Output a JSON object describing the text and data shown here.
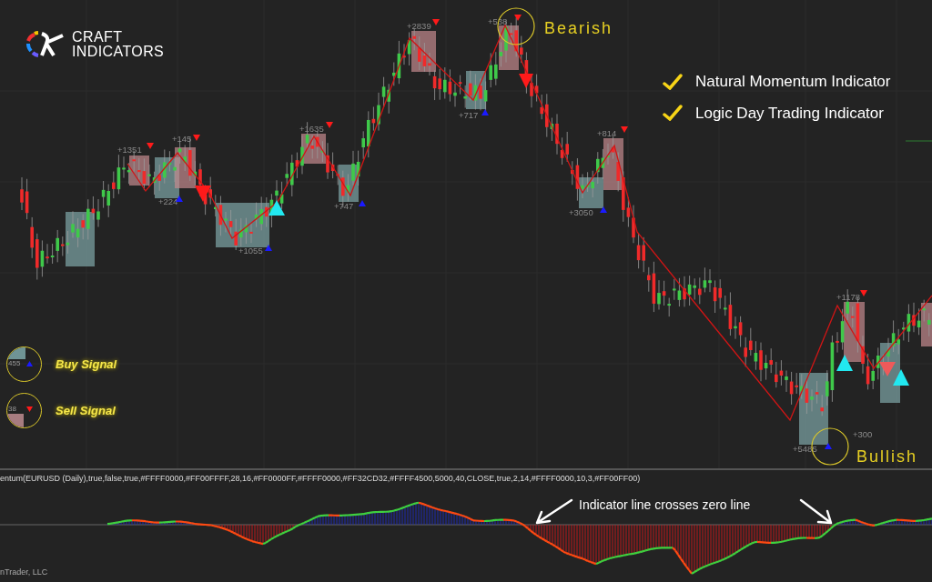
{
  "logo": {
    "line_1": "CRAFT",
    "line_2": "INDICATORS"
  },
  "features": [
    {
      "label": "Natural Momentum Indicator",
      "checked": true
    },
    {
      "label": "Logic Day Trading Indicator",
      "checked": true
    }
  ],
  "price_chart": {
    "trade_labels": [
      {
        "text": "+1351",
        "kind": "sell"
      },
      {
        "text": "+145",
        "kind": "sell"
      },
      {
        "text": "+224",
        "kind": "buy"
      },
      {
        "text": "+1055",
        "kind": "buy"
      },
      {
        "text": "+1635",
        "kind": "sell"
      },
      {
        "text": "+747",
        "kind": "buy"
      },
      {
        "text": "+2839",
        "kind": "sell"
      },
      {
        "text": "+717",
        "kind": "buy"
      },
      {
        "text": "+538",
        "kind": "sell"
      },
      {
        "text": "+814",
        "kind": "sell"
      },
      {
        "text": "+3050",
        "kind": "buy"
      },
      {
        "text": "+1178",
        "kind": "sell"
      },
      {
        "text": "+5485",
        "kind": "buy"
      },
      {
        "text": "+300",
        "kind": "plain"
      }
    ],
    "callouts": [
      {
        "text": "Bearish"
      },
      {
        "text": "Bullish"
      }
    ]
  },
  "legend": [
    {
      "kind": "buy",
      "sample": "455",
      "label": "Buy Signal"
    },
    {
      "kind": "sell",
      "sample": "38",
      "label": "Sell Signal"
    }
  ],
  "indicator_panel": {
    "parameters": "entum(EURUSD (Daily),true,false,true,#FFFF0000,#FF00FFFF,28,16,#FF0000FF,#FFFF0000,#FF32CD32,#FFFF4500,5000,40,CLOSE,true,2,14,#FFFF0000,10,3,#FF00FF00)",
    "annotation": "Indicator line crosses zero line",
    "copyright": "nTrader, LLC"
  }
}
